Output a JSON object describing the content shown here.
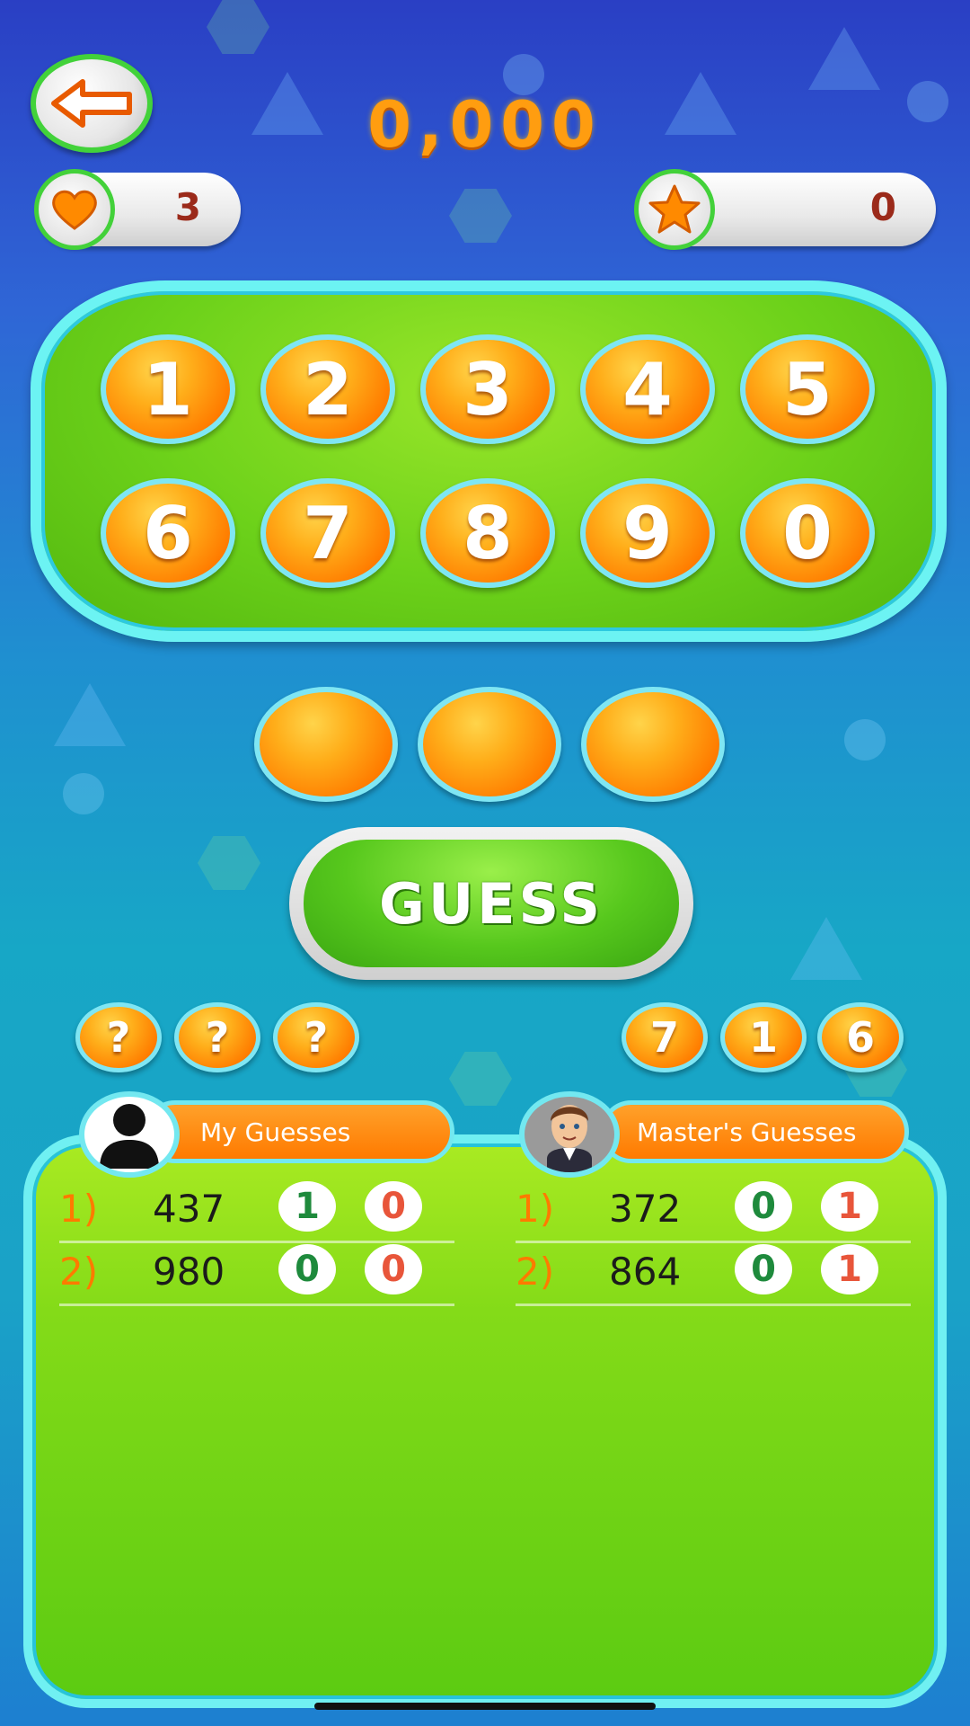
{
  "header": {
    "score": "0,000"
  },
  "lives": {
    "value": "3",
    "icon": "heart-icon"
  },
  "stars": {
    "value": "0",
    "icon": "star-icon"
  },
  "keypad": {
    "keys": [
      "1",
      "2",
      "3",
      "4",
      "5",
      "6",
      "7",
      "8",
      "9",
      "0"
    ]
  },
  "guess_button": {
    "label": "GUESS"
  },
  "my_secret": [
    "?",
    "?",
    "?"
  ],
  "master_secret": [
    "7",
    "1",
    "6"
  ],
  "my_guesses": {
    "title": "My Guesses",
    "rows": [
      {
        "index": "1)",
        "guess": "437",
        "correct_place": "1",
        "correct_digit": "0"
      },
      {
        "index": "2)",
        "guess": "980",
        "correct_place": "0",
        "correct_digit": "0"
      }
    ]
  },
  "master_guesses": {
    "title": "Master's Guesses",
    "rows": [
      {
        "index": "1)",
        "guess": "372",
        "correct_place": "0",
        "correct_digit": "1"
      },
      {
        "index": "2)",
        "guess": "864",
        "correct_place": "0",
        "correct_digit": "1"
      }
    ]
  },
  "colors": {
    "accent_orange": "#ff7d00",
    "panel_green": "#6cd11a",
    "border_cyan": "#70f0f2"
  }
}
